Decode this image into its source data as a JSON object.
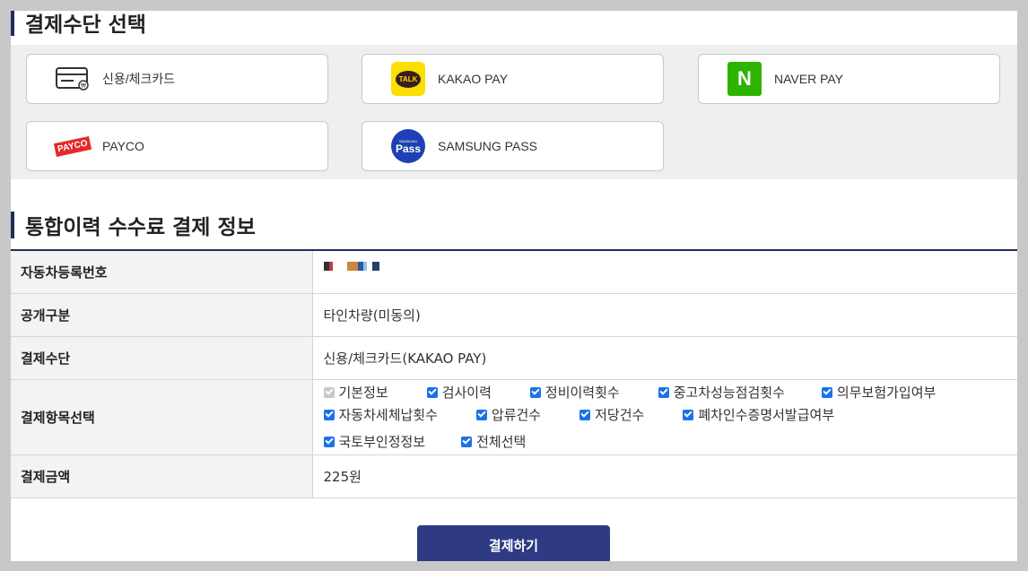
{
  "payment_section": {
    "title": "결제수단 선택",
    "methods": [
      {
        "label": "신용/체크카드",
        "icon": "credit-card-icon"
      },
      {
        "label": "KAKAO PAY",
        "icon": "kakao-pay-icon",
        "icon_text": "TALK"
      },
      {
        "label": "NAVER PAY",
        "icon": "naver-pay-icon",
        "icon_text": "N"
      },
      {
        "label": "PAYCO",
        "icon": "payco-icon",
        "icon_text": "PAYCO"
      },
      {
        "label": "SAMSUNG PASS",
        "icon": "samsung-pass-icon",
        "icon_text_small": "SAMSUNG",
        "icon_text": "Pass"
      }
    ]
  },
  "info_section": {
    "title": "통합이력 수수료 결제 정보",
    "rows": {
      "plate": {
        "label": "자동차등록번호"
      },
      "disclosure": {
        "label": "공개구분",
        "value": "타인차량(미동의)"
      },
      "method": {
        "label": "결제수단",
        "value": "신용/체크카드(KAKAO PAY)"
      },
      "items": {
        "label": "결제항목선택",
        "options": [
          {
            "label": "기본정보",
            "checked": true,
            "disabled": true
          },
          {
            "label": "검사이력",
            "checked": true
          },
          {
            "label": "정비이력횟수",
            "checked": true
          },
          {
            "label": "중고차성능점검횟수",
            "checked": true
          },
          {
            "label": "의무보험가입여부",
            "checked": true
          },
          {
            "label": "자동차세체납횟수",
            "checked": true
          },
          {
            "label": "압류건수",
            "checked": true
          },
          {
            "label": "저당건수",
            "checked": true
          },
          {
            "label": "폐차인수증명서발급여부",
            "checked": true
          },
          {
            "label": "국토부인정정보",
            "checked": true
          },
          {
            "label": "전체선택",
            "checked": true
          }
        ]
      },
      "amount": {
        "label": "결제금액",
        "value": "225원"
      }
    }
  },
  "submit_label": "결제하기",
  "colors": {
    "accent": "#2e3b84",
    "checkbox": "#1a73e8",
    "kakao": "#f9e000",
    "naver": "#2db400",
    "payco": "#e32a2a",
    "samsung": "#1e40b4"
  }
}
